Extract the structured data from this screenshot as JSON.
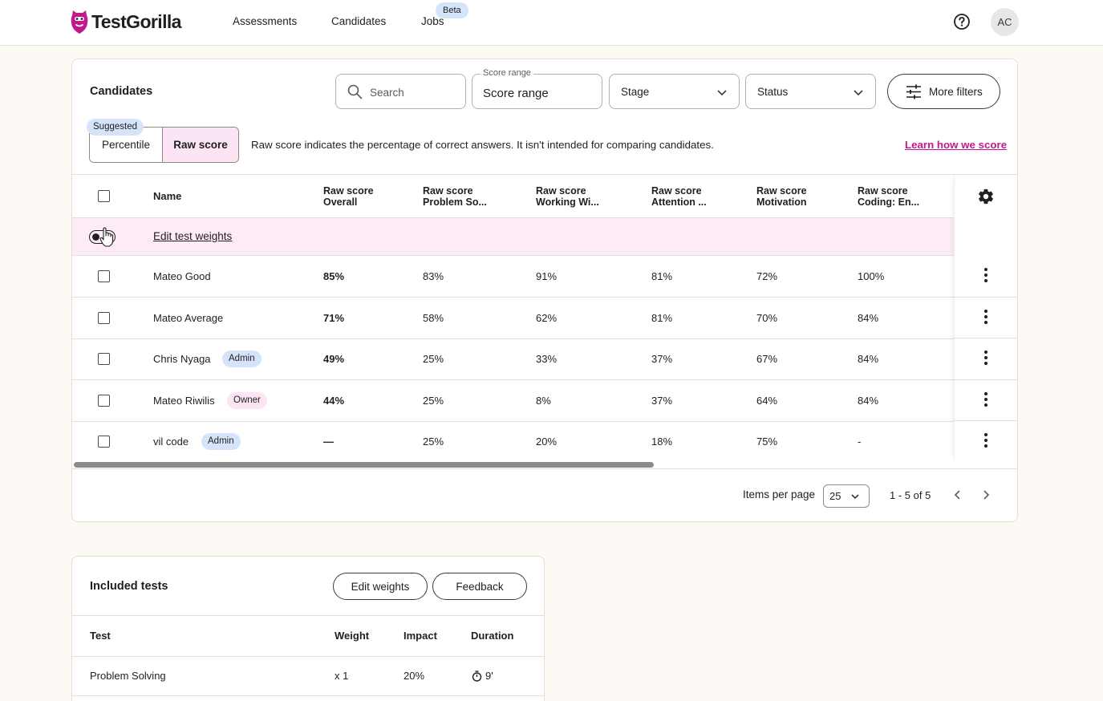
{
  "app": {
    "brand": "TestGorilla",
    "accent_color": "#c2188b"
  },
  "nav": {
    "links": [
      "Assessments",
      "Candidates",
      "Jobs"
    ],
    "beta_badge": "Beta",
    "avatar_initials": "AC"
  },
  "candidates": {
    "title": "Candidates",
    "search_placeholder": "Search",
    "score_range_label": "Score range",
    "score_range_value": "Score range",
    "stage_label": "Stage",
    "status_label": "Status",
    "more_filters_label": "More filters",
    "suggested_badge": "Suggested",
    "toggle": {
      "percentile": "Percentile",
      "raw": "Raw score"
    },
    "raw_description": "Raw score indicates the percentage of correct answers. It isn't intended for comparing candidates.",
    "learn_link": "Learn how we score",
    "table": {
      "name_header": "Name",
      "columns": [
        {
          "top": "Raw score",
          "sub": "Overall"
        },
        {
          "top": "Raw score",
          "sub": "Problem So..."
        },
        {
          "top": "Raw score",
          "sub": "Working Wi..."
        },
        {
          "top": "Raw score",
          "sub": "Attention ..."
        },
        {
          "top": "Raw score",
          "sub": "Motivation"
        },
        {
          "top": "Raw score",
          "sub": "Coding: En..."
        }
      ],
      "edit_weights_link": "Edit test weights",
      "rows": [
        {
          "name": "Mateo Good",
          "badge": "",
          "overall": "85%",
          "s1": "83%",
          "s2": "91%",
          "s3": "81%",
          "s4": "72%",
          "s5": "100%"
        },
        {
          "name": "Mateo Average",
          "badge": "",
          "overall": "71%",
          "s1": "58%",
          "s2": "62%",
          "s3": "81%",
          "s4": "70%",
          "s5": "84%"
        },
        {
          "name": "Chris Nyaga",
          "badge": "Admin",
          "overall": "49%",
          "s1": "25%",
          "s2": "33%",
          "s3": "37%",
          "s4": "67%",
          "s5": "84%"
        },
        {
          "name": "Mateo Riwilis",
          "badge": "Owner",
          "overall": "44%",
          "s1": "25%",
          "s2": "8%",
          "s3": "37%",
          "s4": "64%",
          "s5": "84%"
        },
        {
          "name": "vil code",
          "badge": "Admin",
          "overall": "—",
          "s1": "25%",
          "s2": "20%",
          "s3": "18%",
          "s4": "75%",
          "s5": "-"
        }
      ]
    },
    "pagination": {
      "items_per_page_label": "Items per page",
      "items_per_page_value": "25",
      "range": "1 - 5 of 5"
    }
  },
  "included_tests": {
    "title": "Included tests",
    "edit_weights_button": "Edit weights",
    "feedback_button": "Feedback",
    "headers": {
      "test": "Test",
      "weight": "Weight",
      "impact": "Impact",
      "duration": "Duration"
    },
    "rows": [
      {
        "test": "Problem Solving",
        "weight": "x 1",
        "impact": "20%",
        "duration": "9'"
      }
    ]
  }
}
